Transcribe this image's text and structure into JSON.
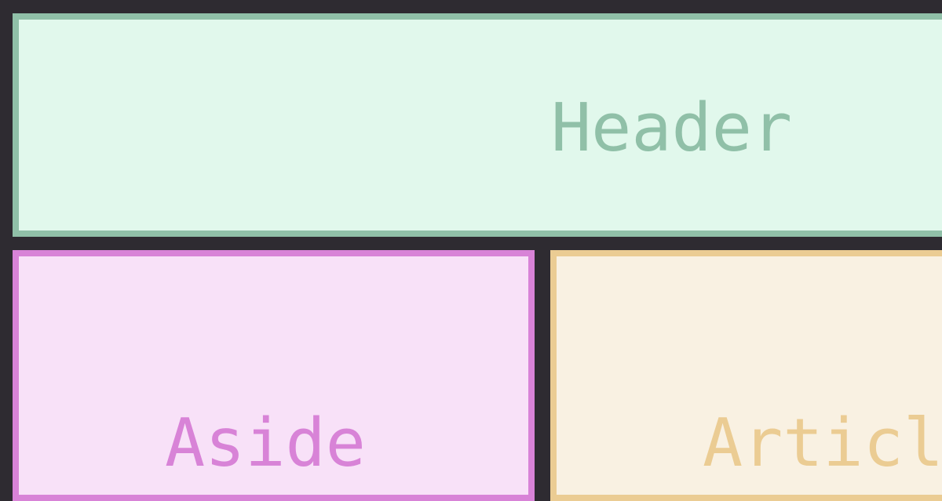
{
  "layout": {
    "header": {
      "label": "Header",
      "background": "#e1f8ec",
      "border_color": "#90c0a8",
      "text_color": "#90c0a8"
    },
    "aside": {
      "label": "Aside",
      "background": "#f8e1f8",
      "border_color": "#d883d7",
      "text_color": "#d883d7"
    },
    "article": {
      "label": "Articl",
      "background": "#f9f1e2",
      "border_color": "#ebcc93",
      "text_color": "#ebcc93"
    }
  },
  "page": {
    "background": "#2e2b31"
  }
}
